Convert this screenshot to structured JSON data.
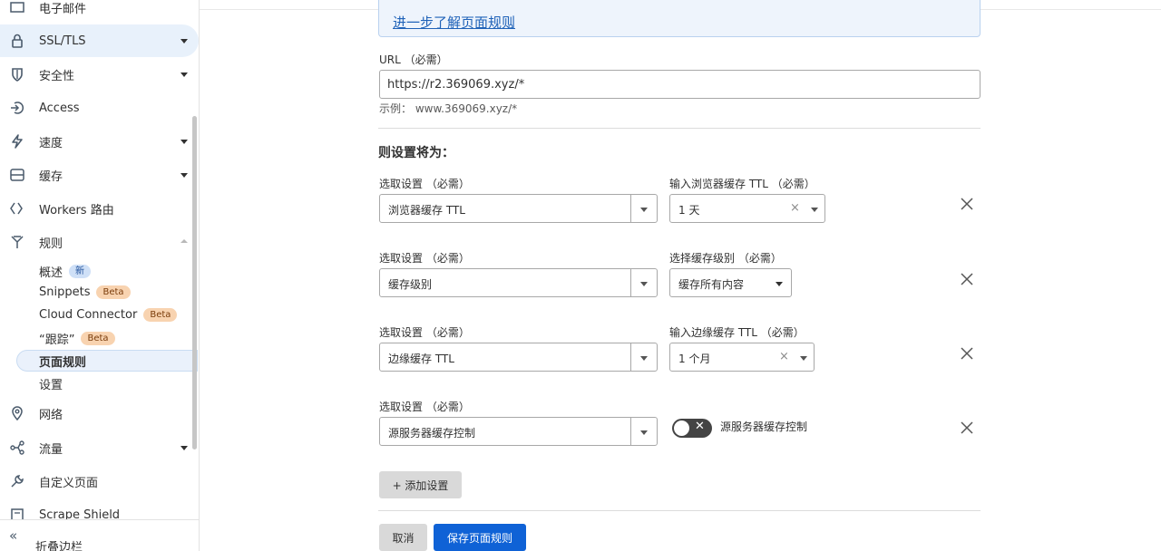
{
  "sidebar": {
    "top_partial": "电子邮件",
    "items": [
      {
        "label": "SSL/TLS",
        "icon": "lock-icon"
      },
      {
        "label": "安全性",
        "icon": "shield-icon"
      },
      {
        "label": "Access",
        "icon": "access-icon"
      },
      {
        "label": "速度",
        "icon": "lightning-icon"
      },
      {
        "label": "缓存",
        "icon": "cache-icon"
      },
      {
        "label": "Workers 路由",
        "icon": "workers-icon"
      },
      {
        "label": "规则",
        "icon": "rules-icon"
      },
      {
        "label": "网络",
        "icon": "location-pin-icon"
      },
      {
        "label": "流量",
        "icon": "traffic-icon"
      },
      {
        "label": "自定义页面",
        "icon": "wrench-icon"
      },
      {
        "label": "Scrape Shield",
        "icon": "document-icon"
      }
    ],
    "rules_sub": [
      {
        "label": "概述",
        "badge": "新"
      },
      {
        "label": "Snippets",
        "badge": "Beta"
      },
      {
        "label": "Cloud Connector",
        "badge": "Beta"
      },
      {
        "label": "“跟踪”",
        "badge": "Beta"
      },
      {
        "label": "页面规则",
        "badge": ""
      },
      {
        "label": "设置",
        "badge": ""
      }
    ],
    "collapse_label": "折叠边栏"
  },
  "info": {
    "link_text": "进一步了解页面规则",
    "suffix": "。"
  },
  "url": {
    "label": "URL （必需）",
    "value": "https://r2.369069.xyz/*",
    "example": "示例：  www.369069.xyz/*"
  },
  "settings_heading": "则设置将为：",
  "settings": [
    {
      "select_label": "选取设置 （必需）",
      "select_value": "浏览器缓存 TTL",
      "value_label": "输入浏览器缓存 TTL （必需）",
      "value": "1 天"
    },
    {
      "select_label": "选取设置 （必需）",
      "select_value": "缓存级别",
      "value_label": "选择缓存级别 （必需）",
      "value": "缓存所有内容"
    },
    {
      "select_label": "选取设置 （必需）",
      "select_value": "边缘缓存 TTL",
      "value_label": "输入边缘缓存 TTL （必需）",
      "value": "1 个月"
    },
    {
      "select_label": "选取设置 （必需）",
      "select_value": "源服务器缓存控制",
      "toggle_text": "✕",
      "toggle_label": "源服务器缓存控制"
    }
  ],
  "add_setting_label": "+ 添加设置",
  "cancel_label": "取消",
  "save_label": "保存页面规则"
}
